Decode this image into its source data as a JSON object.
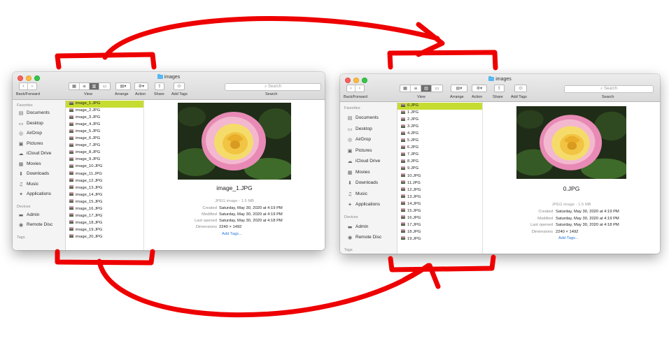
{
  "windows": [
    {
      "title": "images",
      "toolbar": {
        "back_forward": "Back/Forward",
        "view": "View",
        "arrange": "Arrange",
        "action": "Action",
        "share": "Share",
        "add_tags": "Add Tags",
        "search_placeholder": "Search",
        "search_label": "Search"
      },
      "sidebar": {
        "favorites_header": "Favorites",
        "favorites": [
          {
            "label": "Documents",
            "icon": "documents-icon"
          },
          {
            "label": "Desktop",
            "icon": "desktop-icon"
          },
          {
            "label": "AirDrop",
            "icon": "airdrop-icon"
          },
          {
            "label": "Pictures",
            "icon": "pictures-icon"
          },
          {
            "label": "iCloud Drive",
            "icon": "icloud-icon"
          },
          {
            "label": "Movies",
            "icon": "movies-icon"
          },
          {
            "label": "Downloads",
            "icon": "downloads-icon"
          },
          {
            "label": "Music",
            "icon": "music-icon"
          },
          {
            "label": "Applications",
            "icon": "applications-icon"
          }
        ],
        "devices_header": "Devices",
        "devices": [
          {
            "label": "Admin",
            "icon": "drive-icon"
          },
          {
            "label": "Remote Disc",
            "icon": "disc-icon"
          }
        ],
        "tags_header": "Tags"
      },
      "files": [
        "image_1.JPG",
        "image_2.JPG",
        "image_3.JPG",
        "image_4.JPG",
        "image_5.JPG",
        "image_6.JPG",
        "image_7.JPG",
        "image_8.JPG",
        "image_9.JPG",
        "image_10.JPG",
        "image_11.JPG",
        "image_12.JPG",
        "image_13.JPG",
        "image_14.JPG",
        "image_15.JPG",
        "image_16.JPG",
        "image_17.JPG",
        "image_18.JPG",
        "image_19.JPG",
        "image_20.JPG"
      ],
      "selected_index": 0,
      "preview": {
        "name": "image_1.JPG",
        "kind": "JPEG image - 1.5 MB",
        "meta": [
          {
            "k": "Created",
            "v": "Saturday, May 30, 2020 at 4:19 PM"
          },
          {
            "k": "Modified",
            "v": "Saturday, May 30, 2020 at 4:19 PM"
          },
          {
            "k": "Last opened",
            "v": "Saturday, May 30, 2020 at 4:18 PM"
          },
          {
            "k": "Dimensions",
            "v": "2240 × 1492"
          }
        ],
        "add_tags": "Add Tags..."
      }
    },
    {
      "title": "images",
      "toolbar": {
        "back_forward": "Back/Forward",
        "view": "View",
        "arrange": "Arrange",
        "action": "Action",
        "share": "Share",
        "add_tags": "Add Tags",
        "search_placeholder": "Search",
        "search_label": "Search"
      },
      "sidebar": {
        "favorites_header": "Favorites",
        "favorites": [
          {
            "label": "Documents",
            "icon": "documents-icon"
          },
          {
            "label": "Desktop",
            "icon": "desktop-icon"
          },
          {
            "label": "AirDrop",
            "icon": "airdrop-icon"
          },
          {
            "label": "Pictures",
            "icon": "pictures-icon"
          },
          {
            "label": "iCloud Drive",
            "icon": "icloud-icon"
          },
          {
            "label": "Movies",
            "icon": "movies-icon"
          },
          {
            "label": "Downloads",
            "icon": "downloads-icon"
          },
          {
            "label": "Music",
            "icon": "music-icon"
          },
          {
            "label": "Applications",
            "icon": "applications-icon"
          }
        ],
        "devices_header": "Devices",
        "devices": [
          {
            "label": "Admin",
            "icon": "drive-icon"
          },
          {
            "label": "Remote Disc",
            "icon": "disc-icon"
          }
        ],
        "tags_header": "Tags"
      },
      "files": [
        "0.JPG",
        "1.JPG",
        "2.JPG",
        "3.JPG",
        "4.JPG",
        "5.JPG",
        "6.JPG",
        "7.JPG",
        "8.JPG",
        "9.JPG",
        "10.JPG",
        "11.JPG",
        "12.JPG",
        "13.JPG",
        "14.JPG",
        "15.JPG",
        "16.JPG",
        "17.JPG",
        "18.JPG",
        "19.JPG"
      ],
      "selected_index": 0,
      "preview": {
        "name": "0.JPG",
        "kind": "JPEG image - 1.5 MB",
        "meta": [
          {
            "k": "Created",
            "v": "Saturday, May 30, 2020 at 4:19 PM"
          },
          {
            "k": "Modified",
            "v": "Saturday, May 30, 2020 at 4:19 PM"
          },
          {
            "k": "Last opened",
            "v": "Saturday, May 30, 2020 at 4:18 PM"
          },
          {
            "k": "Dimensions",
            "v": "2240 × 1492"
          }
        ],
        "add_tags": "Add Tags..."
      }
    }
  ],
  "annotation": {
    "color": "#ee0000"
  },
  "selection_color": "#c7dc31"
}
